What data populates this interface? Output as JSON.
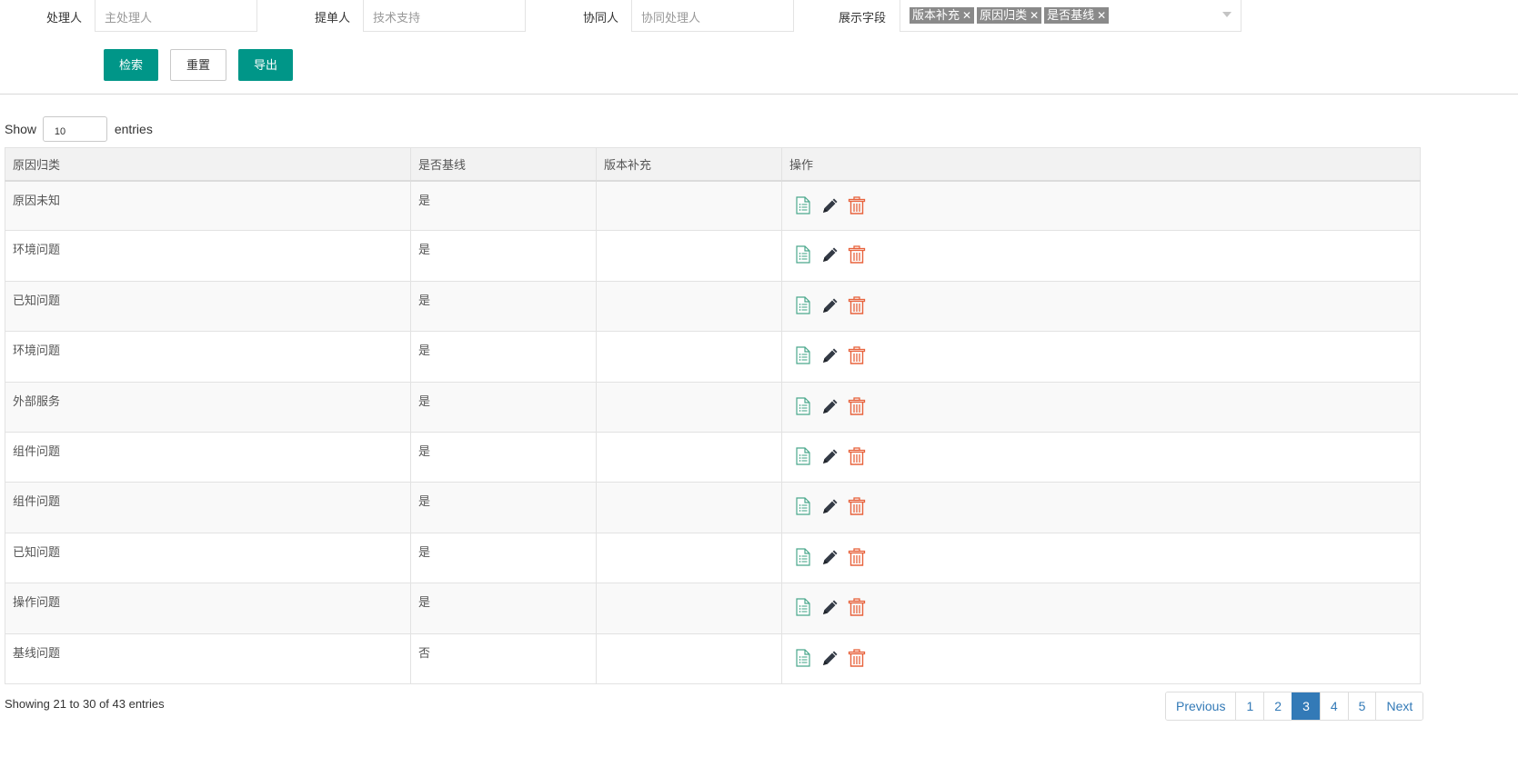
{
  "filters": {
    "handler_label": "处理人",
    "handler_placeholder": "主处理人",
    "submitter_label": "提单人",
    "submitter_placeholder": "技术支持",
    "collaborator_label": "协同人",
    "collaborator_placeholder": "协同处理人",
    "display_fields_label": "展示字段",
    "display_fields_tags": [
      "版本补充",
      "原因归类",
      "是否基线"
    ],
    "tag_remove_glyph": "✕"
  },
  "buttons": {
    "search": "检索",
    "reset": "重置",
    "export": "导出"
  },
  "length": {
    "show": "Show",
    "value": "10",
    "entries": "entries"
  },
  "table": {
    "columns": [
      "原因归类",
      "是否基线",
      "版本补充",
      "操作"
    ],
    "rows": [
      [
        "原因未知",
        "是",
        ""
      ],
      [
        "环境问题",
        "是",
        ""
      ],
      [
        "已知问题",
        "是",
        ""
      ],
      [
        "环境问题",
        "是",
        ""
      ],
      [
        "外部服务",
        "是",
        ""
      ],
      [
        "组件问题",
        "是",
        ""
      ],
      [
        "组件问题",
        "是",
        ""
      ],
      [
        "已知问题",
        "是",
        ""
      ],
      [
        "操作问题",
        "是",
        ""
      ],
      [
        "基线问题",
        "否",
        ""
      ]
    ],
    "row_actions": [
      "details-icon",
      "edit-pencil-icon",
      "delete-trash-icon"
    ]
  },
  "info": "Showing 21 to 30 of 43 entries",
  "pagination": {
    "previous": "Previous",
    "pages": [
      "1",
      "2",
      "3",
      "4",
      "5"
    ],
    "current": "3",
    "next": "Next"
  },
  "colors": {
    "primary": "#009688",
    "pager_active": "#337ab7",
    "delete_icon": "#e8633d",
    "details_icon": "#4aa88c",
    "edit_icon": "#333a45"
  }
}
